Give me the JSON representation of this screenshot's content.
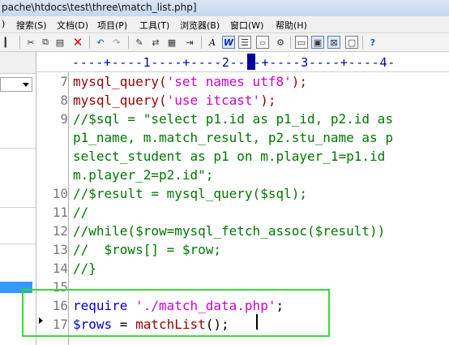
{
  "window": {
    "title": "pache\\htdocs\\test\\three\\match_list.php]"
  },
  "menu": [
    {
      "label": ")"
    },
    {
      "label": "搜索(S)"
    },
    {
      "label": "文档(D)"
    },
    {
      "label": "项目(P)"
    },
    {
      "label": "工具(T)"
    },
    {
      "label": "浏览器(B)"
    },
    {
      "label": "窗口(W)"
    },
    {
      "label": "帮助(H)"
    }
  ],
  "ruler": {
    "text": "----+----1----+----2----+----3----+----4-"
  },
  "lines": [
    {
      "no": "7",
      "parts": [
        {
          "t": "mysql_query(",
          "c": "func"
        },
        {
          "t": "'set names utf8'",
          "c": "str"
        },
        {
          "t": ");",
          "c": "func"
        }
      ]
    },
    {
      "no": "8",
      "parts": [
        {
          "t": "mysql_query(",
          "c": "func"
        },
        {
          "t": "'use itcast'",
          "c": "str"
        },
        {
          "t": ");",
          "c": "func"
        }
      ]
    },
    {
      "no": "9",
      "parts": [
        {
          "t": "//$sql = \"select p1.id as p1_id, p2.id as",
          "c": "com"
        }
      ]
    },
    {
      "no": "",
      "parts": [
        {
          "t": "p1_name, m.match_result, p2.stu_name as p",
          "c": "com"
        }
      ]
    },
    {
      "no": "",
      "parts": [
        {
          "t": "select_student as p1 on m.player_1=p1.id",
          "c": "com"
        }
      ]
    },
    {
      "no": "",
      "parts": [
        {
          "t": "m.player_2=p2.id\";",
          "c": "com"
        }
      ]
    },
    {
      "no": "10",
      "parts": [
        {
          "t": "//$result = mysql_query($sql);",
          "c": "com"
        }
      ]
    },
    {
      "no": "11",
      "parts": [
        {
          "t": "//",
          "c": "com"
        }
      ]
    },
    {
      "no": "12",
      "parts": [
        {
          "t": "//while($row=mysql_fetch_assoc($result))",
          "c": "com"
        }
      ]
    },
    {
      "no": "13",
      "parts": [
        {
          "t": "//  $rows[] = $row;",
          "c": "com"
        }
      ]
    },
    {
      "no": "14",
      "parts": [
        {
          "t": "//}",
          "c": "com"
        }
      ]
    },
    {
      "no": "15",
      "parts": []
    },
    {
      "no": "16",
      "parts": [
        {
          "t": "require ",
          "c": "kw"
        },
        {
          "t": "'./match_data.php'",
          "c": "str"
        },
        {
          "t": ";",
          "c": "txt"
        }
      ]
    },
    {
      "no": "17",
      "parts": [
        {
          "t": "$rows",
          "c": "var"
        },
        {
          "t": " = ",
          "c": "txt"
        },
        {
          "t": "matchList",
          "c": "func"
        },
        {
          "t": "();",
          "c": "txt"
        }
      ]
    }
  ]
}
